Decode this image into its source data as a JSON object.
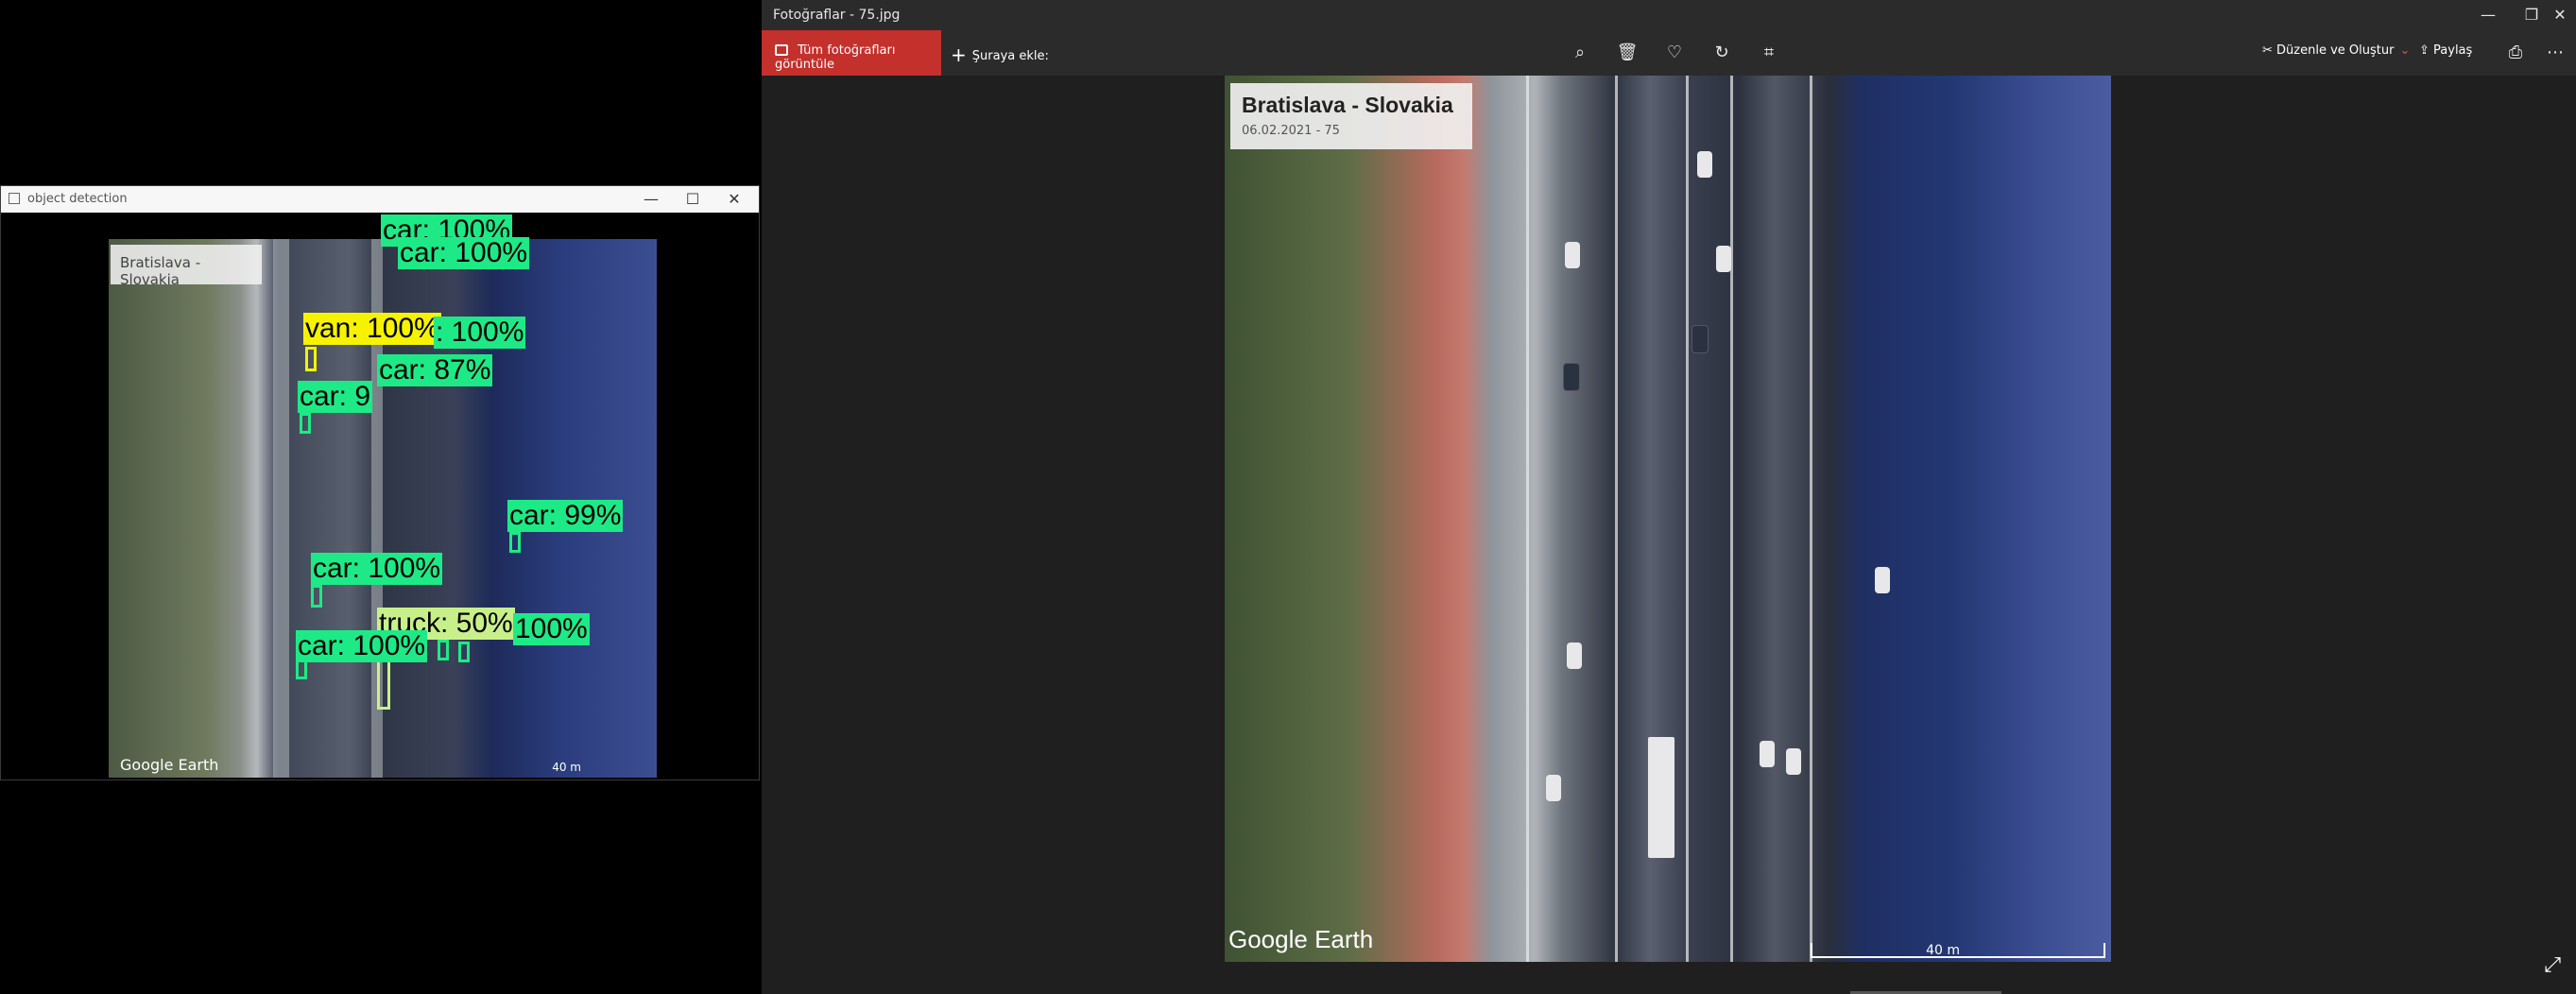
{
  "od_window": {
    "title": "object detection",
    "controls": {
      "minimize": "—",
      "maximize": "☐",
      "close": "✕"
    },
    "photo": {
      "caption": "Bratislava - Slovakia",
      "brand": "Google Earth",
      "scale": "40 m"
    },
    "detections": [
      {
        "label": "car: 100%",
        "class": "car"
      },
      {
        "label": "car: 100%",
        "class": "car"
      },
      {
        "label": "van: 100%",
        "class": "van"
      },
      {
        "label": ": 100%",
        "class": "car"
      },
      {
        "label": "car: 87%",
        "class": "car"
      },
      {
        "label": "car: 9",
        "class": "car"
      },
      {
        "label": "car: 99%",
        "class": "car"
      },
      {
        "label": "car: 100%",
        "class": "car"
      },
      {
        "label": "truck: 50%",
        "class": "truck"
      },
      {
        "label": "100%",
        "class": "car"
      },
      {
        "label": "car: 100%",
        "class": "car"
      }
    ]
  },
  "photos_app": {
    "title": "Fotoğraflar - 75.jpg",
    "controls": {
      "minimize": "—",
      "restore": "❐",
      "close": "✕"
    },
    "toolbar": {
      "view_all": "Tüm fotoğrafları görüntüle",
      "add_to": "Şuraya ekle:",
      "edit_create": "Düzenle ve Oluştur",
      "share": "Paylaş",
      "icons": [
        "zoom-icon",
        "delete-icon",
        "favorite-icon",
        "rotate-icon",
        "crop-icon",
        "print-icon",
        "more-icon"
      ]
    },
    "photo": {
      "caption_title": "Bratislava - Slovakia",
      "caption_sub": "06.02.2021 - 75",
      "brand": "Google Earth",
      "scale": "40 m"
    }
  },
  "colors": {
    "accent": "#c4302b",
    "det_car": "#1dea86",
    "det_van": "#f7f300",
    "det_truck": "#c8f08a"
  }
}
